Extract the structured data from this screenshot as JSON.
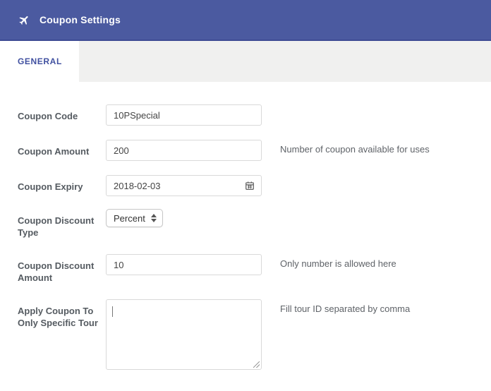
{
  "header": {
    "title": "Coupon Settings",
    "icon": "plane-icon",
    "bg_color": "#4b5aa0",
    "border_color": "#3e4b94"
  },
  "tabs": {
    "active_label": "GENERAL",
    "strip_bg": "#f0f0ef",
    "text_color": "#4050a0"
  },
  "fields": [
    {
      "label": "Coupon Code",
      "value": "10PSpecial",
      "helper": "",
      "type": "text"
    },
    {
      "label": "Coupon Amount",
      "value": "200",
      "helper": "Number of coupon available for uses",
      "type": "text"
    },
    {
      "label": "Coupon Expiry",
      "value": "2018-02-03",
      "helper": "",
      "type": "date",
      "icon": "calendar-icon"
    },
    {
      "label": "Coupon Discount Type",
      "value": "Percent",
      "helper": "",
      "type": "select"
    },
    {
      "label": "Coupon Discount Amount",
      "value": "10",
      "helper": "Only number is allowed here",
      "type": "text"
    },
    {
      "label": "Apply Coupon To Only Specific Tour",
      "value": "",
      "helper": "Fill tour ID separated by comma",
      "type": "textarea"
    }
  ]
}
